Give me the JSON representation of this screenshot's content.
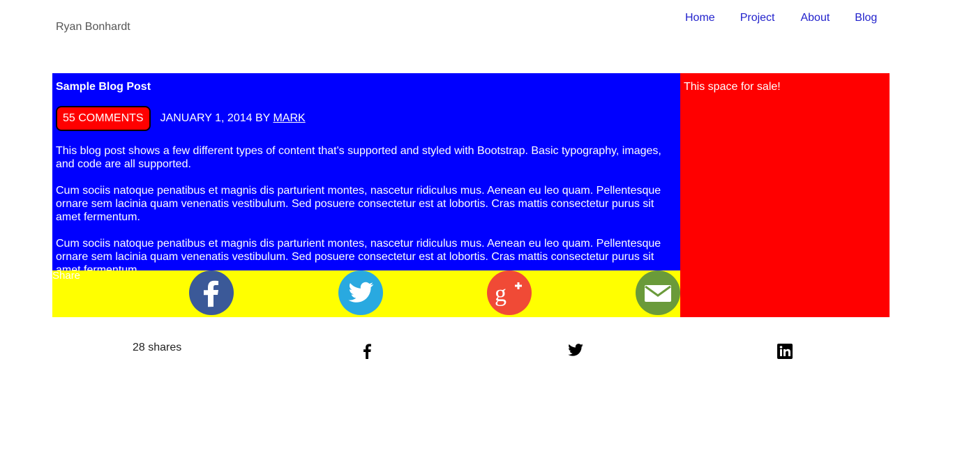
{
  "header": {
    "brand": "Ryan Bonhardt",
    "nav": [
      "Home",
      "Project",
      "About",
      "Blog"
    ]
  },
  "post": {
    "title": "Sample Blog Post",
    "comments_label": "55 COMMENTS",
    "meta_prefix": "JANUARY 1, 2014 BY ",
    "author": "MARK",
    "paragraphs": [
      "This blog post shows a few different types of content that's supported and styled with Bootstrap. Basic typography, images, and code are all supported.",
      "Cum sociis natoque penatibus et magnis dis parturient montes, nascetur ridiculus mus. Aenean eu leo quam. Pellentesque ornare sem lacinia quam venenatis vestibulum. Sed posuere consectetur est at lobortis. Cras mattis consectetur purus sit amet fermentum.",
      "Cum sociis natoque penatibus et magnis dis parturient montes, nascetur ridiculus mus. Aenean eu leo quam. Pellentesque ornare sem lacinia quam venenatis vestibulum. Sed posuere consectetur est at lobortis. Cras mattis consectetur purus sit amet fermentum."
    ]
  },
  "share_bar": {
    "label": "Share",
    "icons": [
      "facebook-icon",
      "twitter-icon",
      "google-plus-icon",
      "email-icon"
    ]
  },
  "sidebar": {
    "text": "This space for sale!"
  },
  "footer_share": {
    "count": "28 shares",
    "icons": [
      "facebook-icon",
      "twitter-icon",
      "linkedin-icon"
    ]
  },
  "colors": {
    "main_bg": "#0000ff",
    "sidebar_bg": "#ff0000",
    "share_bg": "#ffff00",
    "nav_link": "#2222cc",
    "facebook": "#3b5998",
    "twitter": "#29a9e0",
    "google_plus": "#f04a36",
    "email": "#6a9a3a"
  }
}
